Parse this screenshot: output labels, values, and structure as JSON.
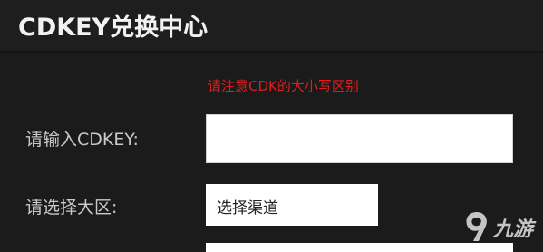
{
  "header": {
    "title": "CDKEY兑换中心"
  },
  "notice": {
    "case_warning": "请注意CDK的大小写区别"
  },
  "form": {
    "cdkey_label": "请输入CDKEY:",
    "cdkey_value": "",
    "region_label": "请选择大区:",
    "region_selected": "选择渠道"
  },
  "watermark": {
    "text": "九游",
    "icon": "9game-logo-icon"
  },
  "colors": {
    "background": "#1b1b1b",
    "warning": "#e01d1d",
    "label": "#c9c9c9",
    "title": "#f2f2f2"
  }
}
